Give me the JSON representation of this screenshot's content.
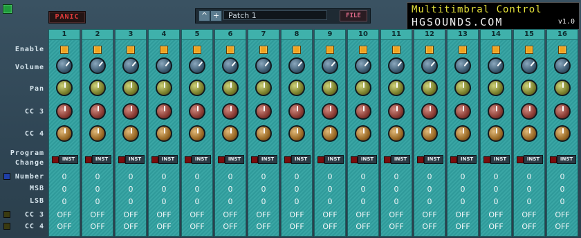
{
  "header": {
    "panic_label": "PANIC",
    "patch_up_label": "^",
    "patch_add_label": "+",
    "patch_name": "Patch 1",
    "file_label": "FILE"
  },
  "logo": {
    "title": "Multitimbral Control",
    "site": "HGSOUNDS.COM",
    "version": "v1.0"
  },
  "row_labels": {
    "enable": "Enable",
    "volume": "Volume",
    "pan": "Pan",
    "cc3": "CC 3",
    "cc4": "CC 4",
    "program": "Program",
    "change": "Change",
    "number": "Number",
    "msb": "MSB",
    "lsb": "LSB",
    "cc3_out": "CC 3",
    "cc4_out": "CC 4"
  },
  "inst_label": "INST",
  "channels": [
    {
      "num": "1",
      "number": "0",
      "msb": "0",
      "lsb": "0",
      "cc3": "OFF",
      "cc4": "OFF"
    },
    {
      "num": "2",
      "number": "0",
      "msb": "0",
      "lsb": "0",
      "cc3": "OFF",
      "cc4": "OFF"
    },
    {
      "num": "3",
      "number": "0",
      "msb": "0",
      "lsb": "0",
      "cc3": "OFF",
      "cc4": "OFF"
    },
    {
      "num": "4",
      "number": "0",
      "msb": "0",
      "lsb": "0",
      "cc3": "OFF",
      "cc4": "OFF"
    },
    {
      "num": "5",
      "number": "0",
      "msb": "0",
      "lsb": "0",
      "cc3": "OFF",
      "cc4": "OFF"
    },
    {
      "num": "6",
      "number": "0",
      "msb": "0",
      "lsb": "0",
      "cc3": "OFF",
      "cc4": "OFF"
    },
    {
      "num": "7",
      "number": "0",
      "msb": "0",
      "lsb": "0",
      "cc3": "OFF",
      "cc4": "OFF"
    },
    {
      "num": "8",
      "number": "0",
      "msb": "0",
      "lsb": "0",
      "cc3": "OFF",
      "cc4": "OFF"
    },
    {
      "num": "9",
      "number": "0",
      "msb": "0",
      "lsb": "0",
      "cc3": "OFF",
      "cc4": "OFF"
    },
    {
      "num": "10",
      "number": "0",
      "msb": "0",
      "lsb": "0",
      "cc3": "OFF",
      "cc4": "OFF"
    },
    {
      "num": "11",
      "number": "0",
      "msb": "0",
      "lsb": "0",
      "cc3": "OFF",
      "cc4": "OFF"
    },
    {
      "num": "12",
      "number": "0",
      "msb": "0",
      "lsb": "0",
      "cc3": "OFF",
      "cc4": "OFF"
    },
    {
      "num": "13",
      "number": "0",
      "msb": "0",
      "lsb": "0",
      "cc3": "OFF",
      "cc4": "OFF"
    },
    {
      "num": "14",
      "number": "0",
      "msb": "0",
      "lsb": "0",
      "cc3": "OFF",
      "cc4": "OFF"
    },
    {
      "num": "15",
      "number": "0",
      "msb": "0",
      "lsb": "0",
      "cc3": "OFF",
      "cc4": "OFF"
    },
    {
      "num": "16",
      "number": "0",
      "msb": "0",
      "lsb": "0",
      "cc3": "OFF",
      "cc4": "OFF"
    }
  ],
  "colors": {
    "enable_led": "#f1a21c",
    "program_led": "#7a0d0d",
    "panic_text": "#e03a3a",
    "logo_title": "#e4e23a",
    "number_indicator": "#1f3fa8",
    "cc_indicator": "#3a3a10",
    "power_led": "#1f9a3a"
  }
}
